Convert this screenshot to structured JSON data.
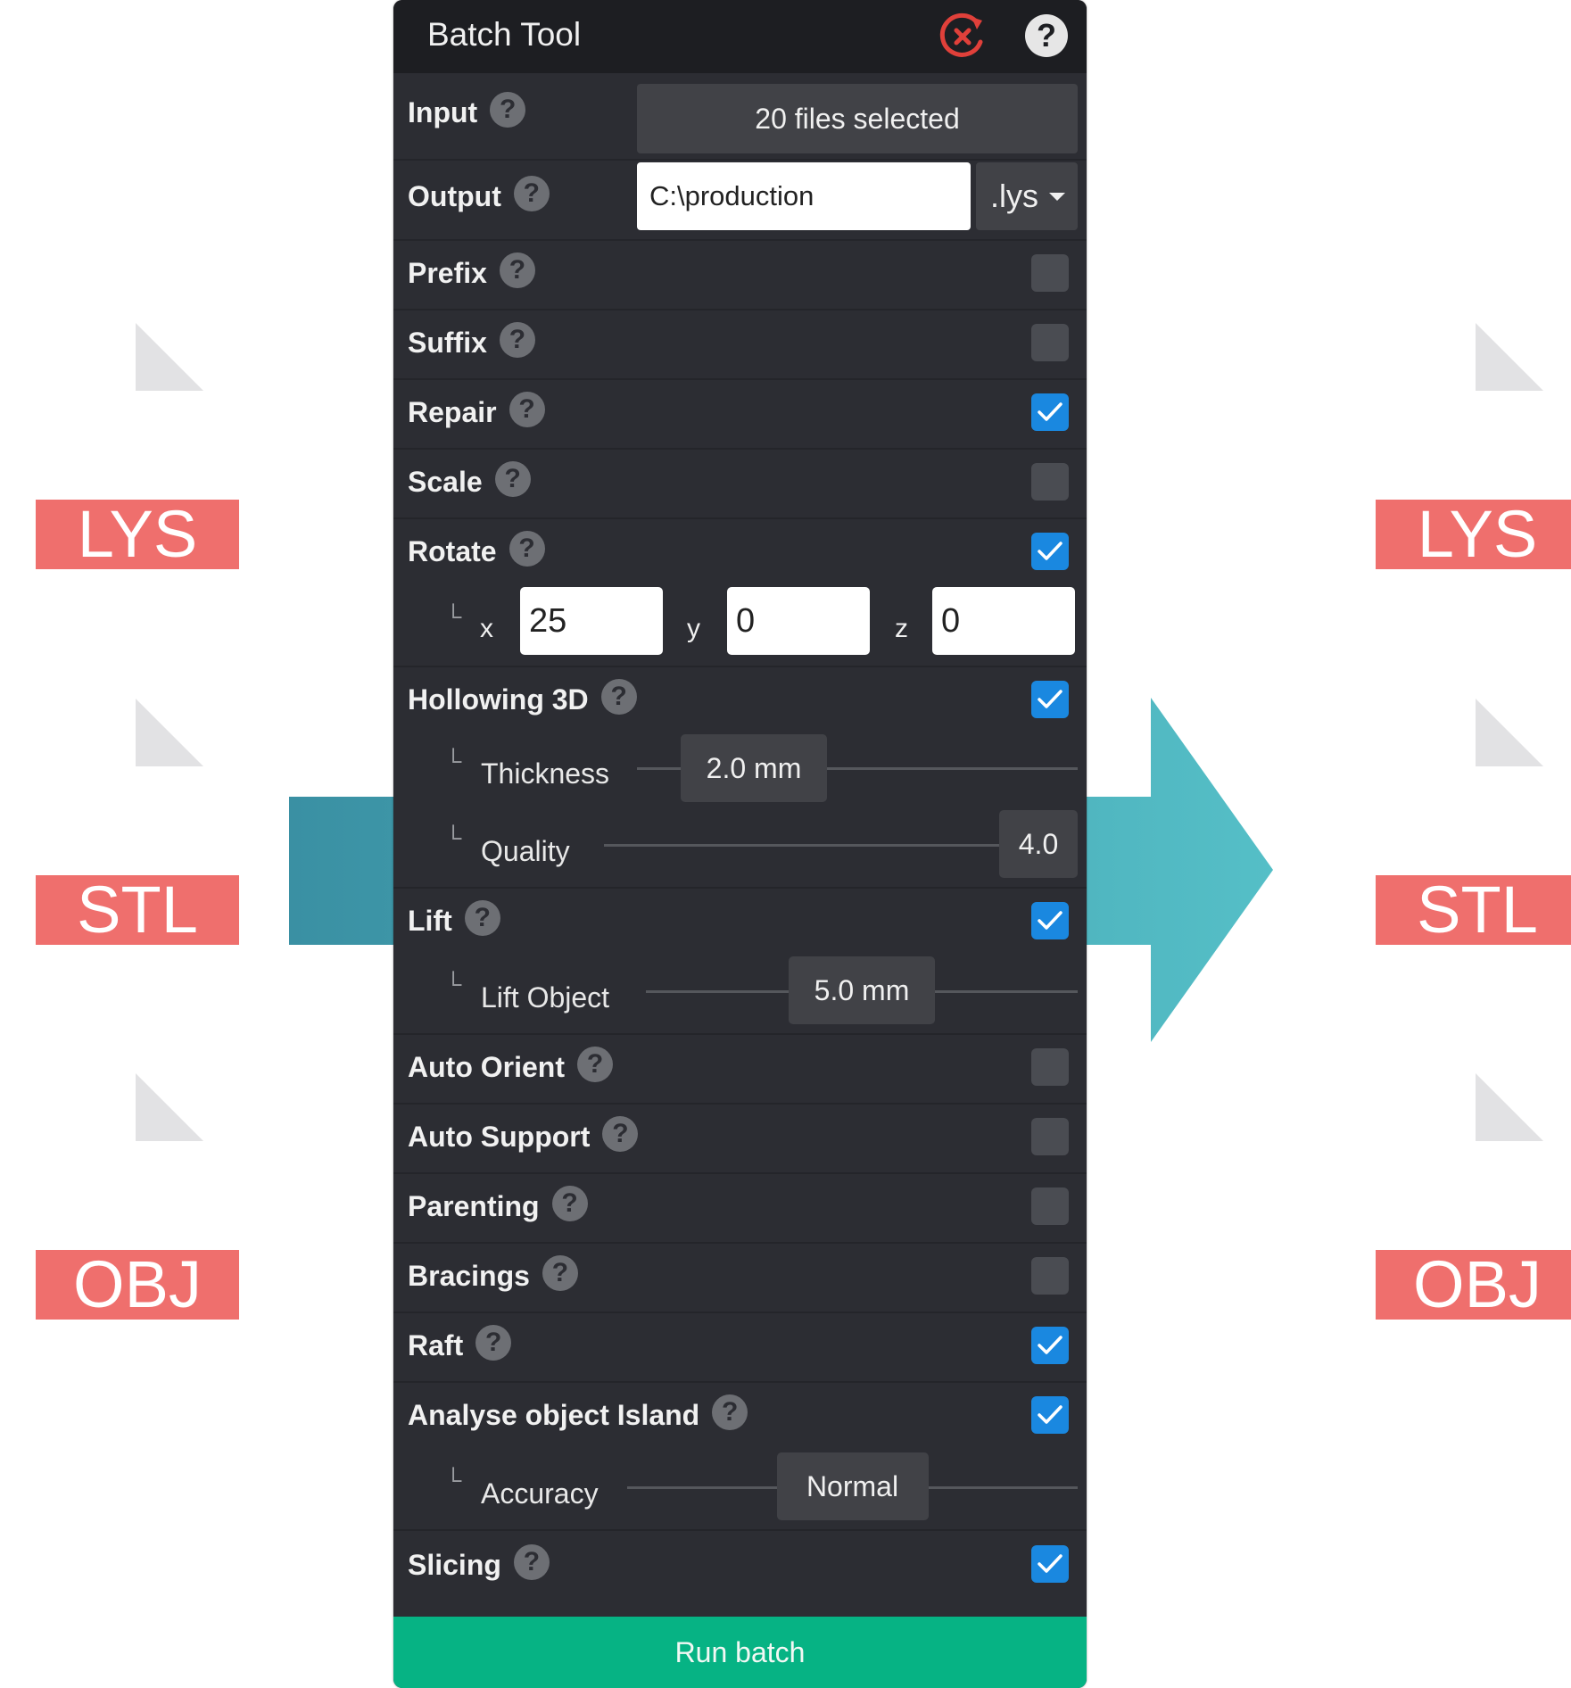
{
  "panel": {
    "title": "Batch Tool",
    "input": {
      "label": "Input",
      "value": "20 files selected"
    },
    "output": {
      "label": "Output",
      "path": "C:\\production",
      "extension": ".lys"
    },
    "options": [
      {
        "label": "Prefix",
        "checked": false
      },
      {
        "label": "Suffix",
        "checked": false
      },
      {
        "label": "Repair",
        "checked": true
      },
      {
        "label": "Scale",
        "checked": false
      },
      {
        "label": "Rotate",
        "checked": true
      },
      {
        "label": "Hollowing 3D",
        "checked": true
      },
      {
        "label": "Lift",
        "checked": true
      },
      {
        "label": "Auto Orient",
        "checked": false
      },
      {
        "label": "Auto Support",
        "checked": false
      },
      {
        "label": "Parenting",
        "checked": false
      },
      {
        "label": "Bracings",
        "checked": false
      },
      {
        "label": "Raft",
        "checked": true
      },
      {
        "label": "Analyse object Island",
        "checked": true
      },
      {
        "label": "Slicing",
        "checked": true
      }
    ],
    "rotate": {
      "x_label": "x",
      "x": "25",
      "y_label": "y",
      "y": "0",
      "z_label": "z",
      "z": "0"
    },
    "hollowing": {
      "thickness_label": "Thickness",
      "thickness_value": "2.0 mm",
      "thickness_level": 0.05,
      "quality_label": "Quality",
      "quality_value": "4.0",
      "quality_level": 1.0
    },
    "lift": {
      "label": "Lift Object",
      "value": "5.0 mm",
      "level": 0.5
    },
    "island": {
      "label": "Accuracy",
      "value": "Normal",
      "level": 0.5
    },
    "sub_indicator": "└",
    "help_glyph": "?",
    "run_label": "Run batch"
  },
  "files_left": [
    "LYS",
    "STL",
    "OBJ"
  ],
  "files_right": [
    "LYS",
    "STL",
    "OBJ"
  ],
  "colors": {
    "panel_bg": "#2c2d33",
    "titlebar_bg": "#1d1e22",
    "checkbox_on": "#1a88e0",
    "run_button": "#06b384",
    "file_tag": "#ef6f6d",
    "arrow_light": "#4fb6c2",
    "arrow_dark": "#3a90a3",
    "close_icon": "#e0403a"
  },
  "icons": {
    "close": "close-circle-icon",
    "help": "question-circle-icon",
    "check": "checkmark-icon",
    "caret": "caret-down-icon",
    "file": "file-sheet-icon",
    "arrow": "right-arrow-icon"
  }
}
